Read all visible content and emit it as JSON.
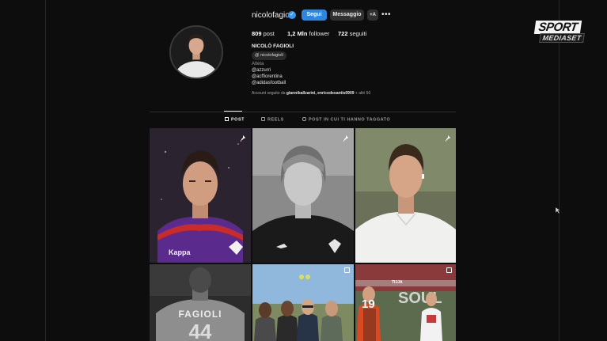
{
  "profile": {
    "username": "nicolofagioli",
    "verified_icon": "verified-badge-icon",
    "follow_label": "Segui",
    "message_label": "Messaggio",
    "add_label": "+A",
    "more_icon": "more-dots-icon",
    "stats": {
      "posts_count": "809",
      "posts_label": "post",
      "followers_count": "1,2 Mln",
      "followers_label": "follower",
      "following_count": "722",
      "following_label": "seguiti"
    },
    "full_name": "NICOLÒ FAGIOLI",
    "threads_handle": "nicolofagioli",
    "bio": {
      "category": "Atleta",
      "line1": "@azzurri",
      "line2": "@acffiorentina",
      "line3": "@adidasfootball"
    },
    "followed_by_prefix": "Account seguito da ",
    "followed_by_names": "gianniballzarini, enricodesantis0909",
    "followed_by_suffix": " + altri 50"
  },
  "tabs": [
    {
      "label": "POST",
      "icon": "grid-icon",
      "active": true
    },
    {
      "label": "REELS",
      "icon": "reels-icon",
      "active": false
    },
    {
      "label": "POST IN CUI TI HANNO TAGGATO",
      "icon": "tagged-icon",
      "active": false
    }
  ],
  "posts": [
    {
      "subject": "player-portrait-purple-jersey",
      "badge": "pin-icon"
    },
    {
      "subject": "teen-portrait-black-and-white",
      "badge": "pin-icon"
    },
    {
      "subject": "player-portrait-white-polo",
      "badge": "pin-icon"
    },
    {
      "subject": "player-back-fagioli-jersey",
      "badge": ""
    },
    {
      "subject": "group-photo-outdoors",
      "badge": "carousel-icon"
    },
    {
      "subject": "match-action-shot",
      "badge": "carousel-icon"
    }
  ],
  "post_texts": {
    "jersey_name": "FAGIOLI",
    "jersey_number": "44",
    "match_player_number": "19",
    "match_player_name": "TIJJA"
  },
  "watermark": {
    "top": "SPORT",
    "bottom": "MEDIASET"
  },
  "colors": {
    "background": "#0d0d0d",
    "follow_button": "#2e86de",
    "secondary_button": "#303030",
    "verified": "#3897f0"
  }
}
